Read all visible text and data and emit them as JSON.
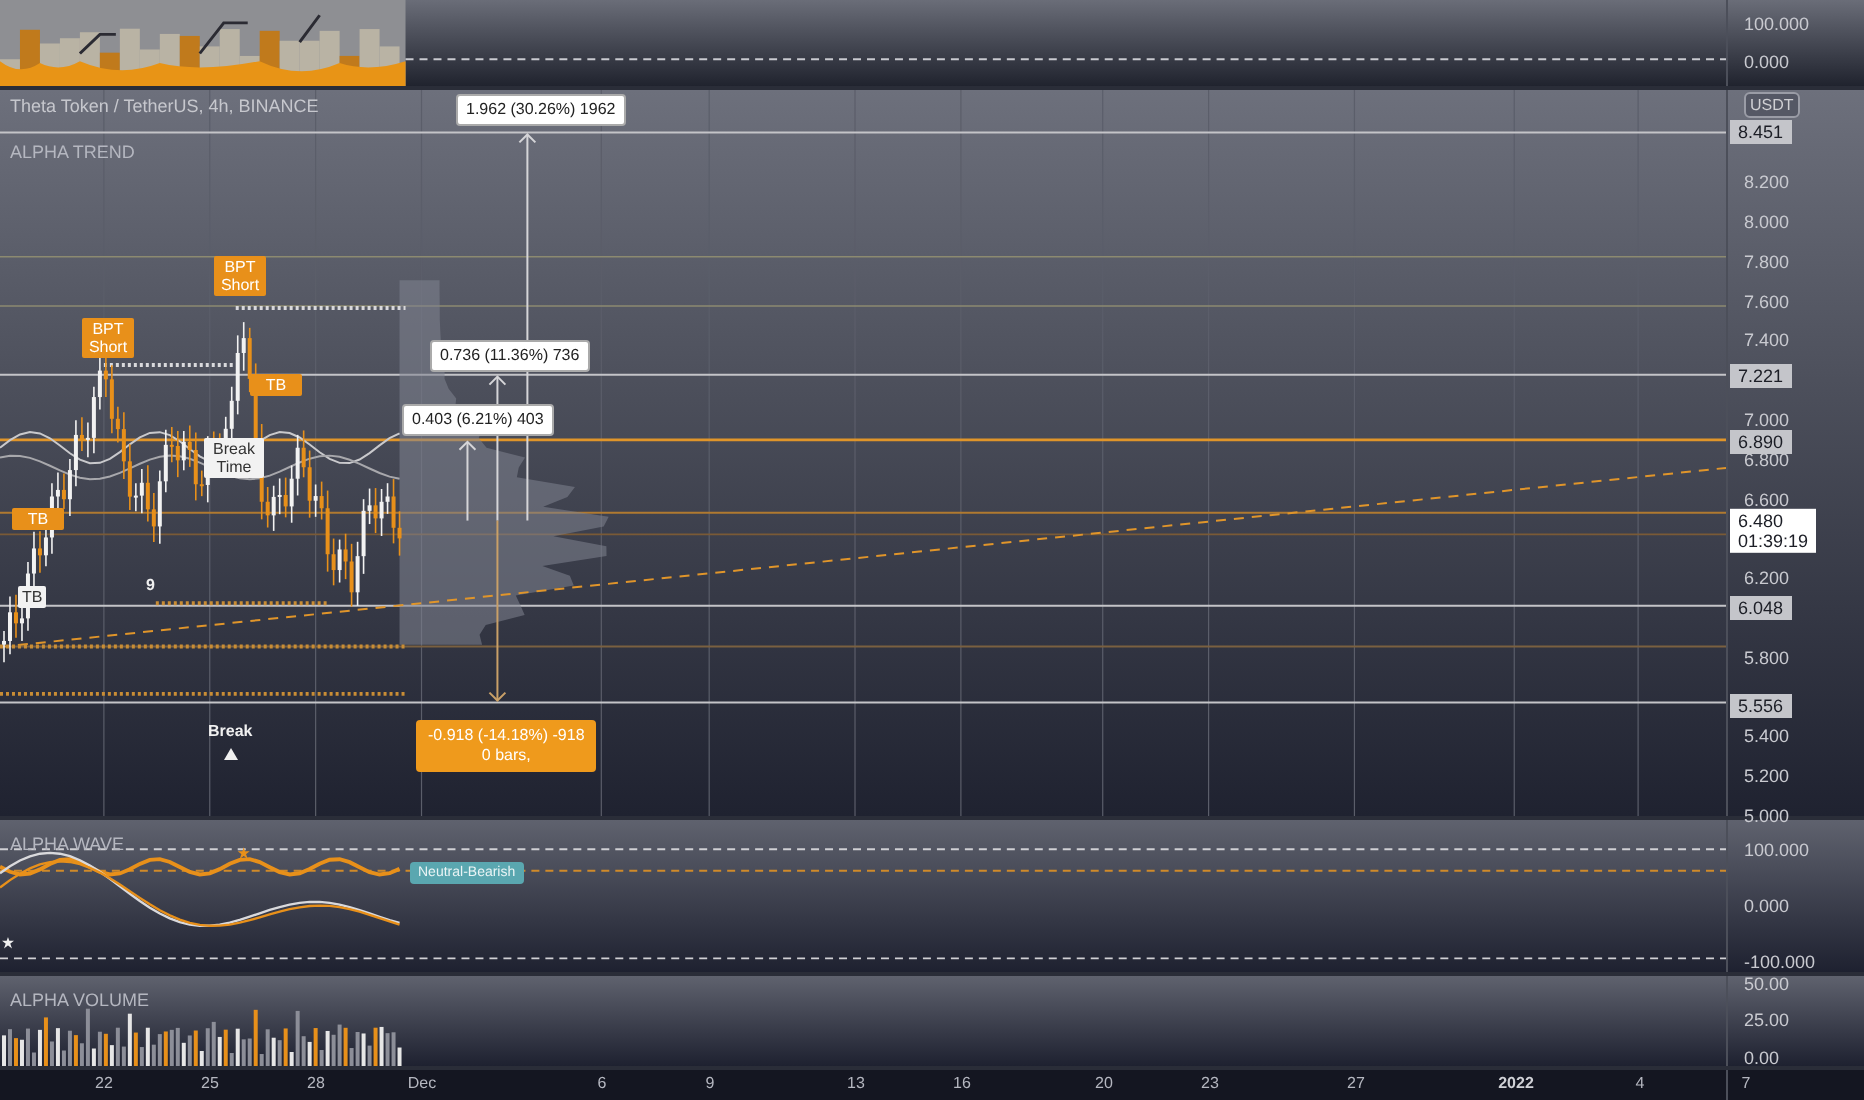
{
  "top_pane": {
    "axis_labels": [
      "100.000",
      "0.000"
    ]
  },
  "main_pane": {
    "symbol_title": "Theta Token / TetherUS, 4h, BINANCE",
    "indicator_title": "ALPHA TREND",
    "currency_badge": "USDT",
    "axis_labels": [
      "8.200",
      "8.000",
      "7.800",
      "7.600",
      "7.400",
      "7.000",
      "6.800",
      "6.600",
      "6.200",
      "5.800",
      "5.400",
      "5.200",
      "5.000"
    ],
    "price_tags": [
      {
        "value": "8.451",
        "kind": "level"
      },
      {
        "value": "7.221",
        "kind": "level"
      },
      {
        "value": "6.890",
        "kind": "level"
      },
      {
        "value": "6.480",
        "time": "01:39:19",
        "kind": "current"
      },
      {
        "value": "6.048",
        "kind": "level"
      },
      {
        "value": "5.556",
        "kind": "level"
      }
    ],
    "markers": [
      {
        "text": "BPT Short",
        "kind": "signal"
      },
      {
        "text": "BPT Short",
        "kind": "signal"
      },
      {
        "text": "TB",
        "kind": "signal"
      },
      {
        "text": "TB",
        "kind": "signal"
      },
      {
        "text": "TB",
        "kind": "note"
      },
      {
        "text": "Break Time",
        "kind": "note"
      },
      {
        "text": "9",
        "kind": "plain"
      },
      {
        "text": "Break",
        "kind": "break"
      }
    ],
    "measures": [
      {
        "text": "1.962 (30.26%) 1962",
        "kind": "up"
      },
      {
        "text": "0.736 (11.36%) 736",
        "kind": "up"
      },
      {
        "text": "0.403 (6.21%) 403",
        "kind": "up"
      },
      {
        "text": "-0.918 (-14.18%) -918",
        "bars": "0 bars,",
        "kind": "down"
      }
    ]
  },
  "wave_pane": {
    "title": "ALPHA WAVE",
    "status_badge": "Neutral-Bearish",
    "axis_labels": [
      "100.000",
      "0.000",
      "-100.000"
    ]
  },
  "volume_pane": {
    "title": "ALPHA VOLUME",
    "axis_labels": [
      "50.00",
      "25.00",
      "0.00"
    ]
  },
  "time_axis": [
    {
      "label": "22",
      "kind": "day"
    },
    {
      "label": "25",
      "kind": "day"
    },
    {
      "label": "28",
      "kind": "day"
    },
    {
      "label": "Dec",
      "kind": "month"
    },
    {
      "label": "6",
      "kind": "day"
    },
    {
      "label": "9",
      "kind": "day"
    },
    {
      "label": "13",
      "kind": "day"
    },
    {
      "label": "16",
      "kind": "day"
    },
    {
      "label": "20",
      "kind": "day"
    },
    {
      "label": "23",
      "kind": "day"
    },
    {
      "label": "27",
      "kind": "day"
    },
    {
      "label": "2022",
      "kind": "year"
    },
    {
      "label": "4",
      "kind": "day"
    },
    {
      "label": "7",
      "kind": "day"
    }
  ]
}
